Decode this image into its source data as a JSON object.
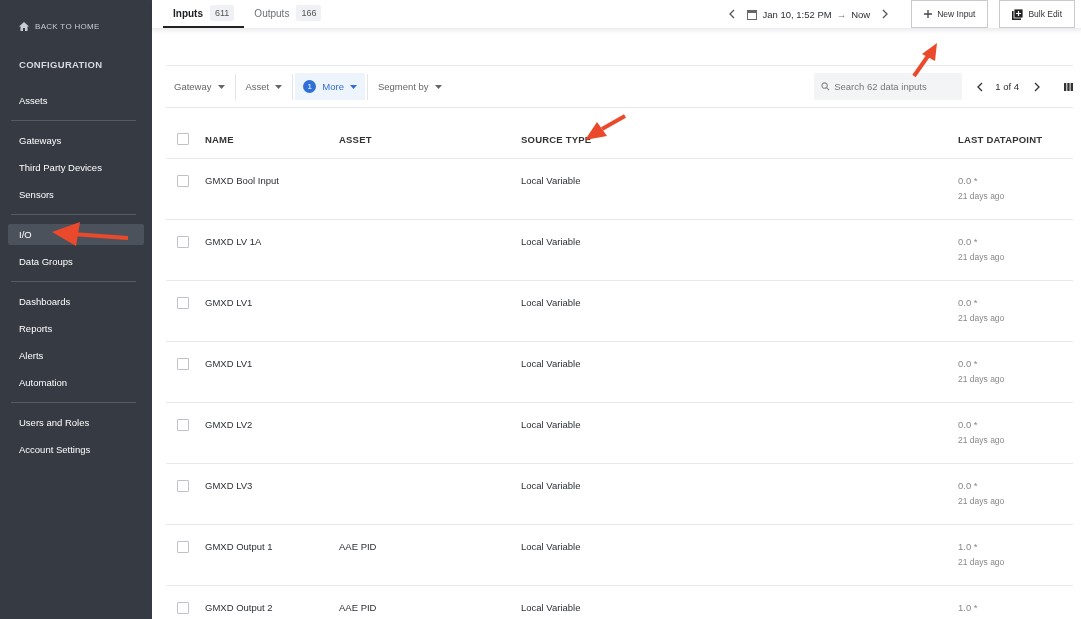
{
  "sidebar": {
    "back_link": "BACK TO HOME",
    "heading": "CONFIGURATION",
    "groups": [
      [
        {
          "label": "Assets",
          "selected": false
        }
      ],
      [
        {
          "label": "Gateways",
          "selected": false
        },
        {
          "label": "Third Party Devices",
          "selected": false
        },
        {
          "label": "Sensors",
          "selected": false
        }
      ],
      [
        {
          "label": "I/O",
          "selected": true
        },
        {
          "label": "Data Groups",
          "selected": false
        }
      ],
      [
        {
          "label": "Dashboards",
          "selected": false
        },
        {
          "label": "Reports",
          "selected": false
        },
        {
          "label": "Alerts",
          "selected": false
        },
        {
          "label": "Automation",
          "selected": false
        }
      ],
      [
        {
          "label": "Users and Roles",
          "selected": false
        },
        {
          "label": "Account Settings",
          "selected": false
        }
      ]
    ]
  },
  "tabs": [
    {
      "label": "Inputs",
      "count": "611",
      "selected": true
    },
    {
      "label": "Outputs",
      "count": "166",
      "selected": false
    }
  ],
  "time_range": {
    "from": "Jan 10, 1:52 PM",
    "arrow": "→",
    "to": "Now"
  },
  "buttons": {
    "new_input": "New Input",
    "bulk_edit": "Bulk Edit"
  },
  "filters": [
    {
      "label": "Gateway",
      "active": false
    },
    {
      "label": "Asset",
      "active": false
    },
    {
      "label": "More",
      "active": true,
      "badge": "1"
    },
    {
      "label": "Segment by",
      "active": false
    }
  ],
  "search": {
    "placeholder": "Search 62 data inputs"
  },
  "pagination": {
    "page": "1",
    "of": "of",
    "total": "4"
  },
  "table": {
    "select_all_checked": false,
    "columns": [
      "NAME",
      "ASSET",
      "SOURCE TYPE",
      "LAST DATAPOINT"
    ],
    "rows": [
      {
        "name": "GMXD Bool Input",
        "asset": "",
        "source_type": "Local Variable",
        "value": "0.0 *",
        "age": "21 days ago",
        "checked": false
      },
      {
        "name": "GMXD LV 1A",
        "asset": "",
        "source_type": "Local Variable",
        "value": "0.0 *",
        "age": "21 days ago",
        "checked": false
      },
      {
        "name": "GMXD LV1",
        "asset": "",
        "source_type": "Local Variable",
        "value": "0.0 *",
        "age": "21 days ago",
        "checked": false
      },
      {
        "name": "GMXD LV1",
        "asset": "",
        "source_type": "Local Variable",
        "value": "0.0 *",
        "age": "21 days ago",
        "checked": false
      },
      {
        "name": "GMXD LV2",
        "asset": "",
        "source_type": "Local Variable",
        "value": "0.0 *",
        "age": "21 days ago",
        "checked": false
      },
      {
        "name": "GMXD LV3",
        "asset": "",
        "source_type": "Local Variable",
        "value": "0.0 *",
        "age": "21 days ago",
        "checked": false
      },
      {
        "name": "GMXD Output 1",
        "asset": "AAE PID",
        "source_type": "Local Variable",
        "value": "1.0 *",
        "age": "21 days ago",
        "checked": false
      },
      {
        "name": "GMXD Output 2",
        "asset": "AAE PID",
        "source_type": "Local Variable",
        "value": "1.0 *",
        "checked": false
      }
    ]
  }
}
